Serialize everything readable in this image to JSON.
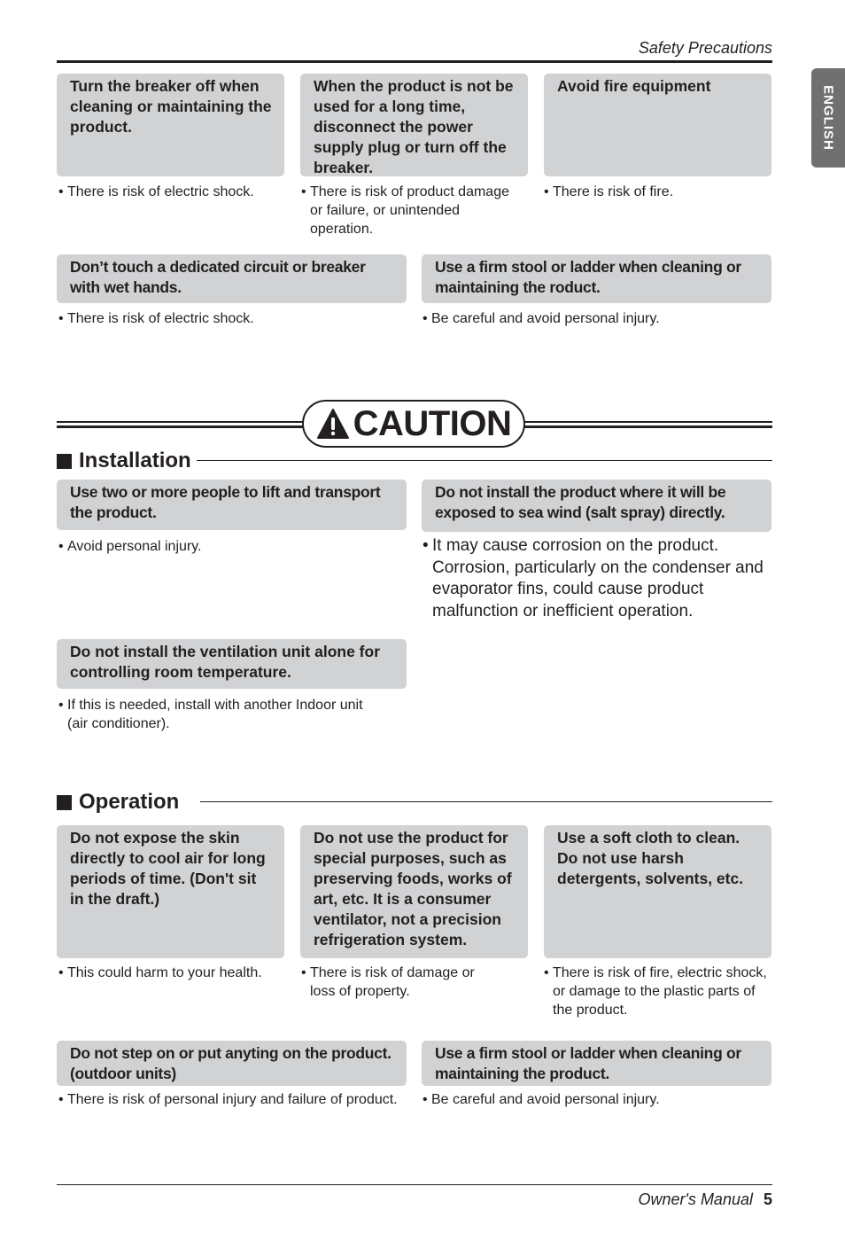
{
  "header": {
    "title": "Safety Precautions"
  },
  "language_tab": "ENGLISH",
  "top_section": {
    "row1": [
      {
        "title": "Turn the breaker off when cleaning or maintaining the product.",
        "notes": [
          "There is risk of electric shock."
        ]
      },
      {
        "title": "When the product is not be used for a long time, disconnect the power supply plug or turn off the breaker.",
        "notes": [
          "There is risk of product damage or failure, or unintended operation."
        ]
      },
      {
        "title": "Avoid fire equipment",
        "notes": [
          "There is risk of fire."
        ]
      }
    ],
    "row2": [
      {
        "title": "Don’t touch a dedicated circuit or breaker with wet hands.",
        "notes": [
          "There is risk of electric shock."
        ]
      },
      {
        "title": "Use a firm stool or ladder when cleaning or maintaining the roduct.",
        "notes": [
          "Be careful and avoid personal injury."
        ]
      }
    ]
  },
  "caution": {
    "label": "CAUTION",
    "icon": "warning-triangle-icon"
  },
  "installation": {
    "heading": "Installation",
    "items": [
      {
        "title": "Use two or more people to lift and transport the product.",
        "notes": [
          "Avoid personal injury."
        ]
      },
      {
        "title": "Do not install the product where it will be exposed to sea wind (salt spray) directly.",
        "notes": [
          "It may cause corrosion on the product. Corrosion, particularly on the condenser and evaporator fins, could cause product malfunction or inefficient operation."
        ]
      },
      {
        "title": "Do not install the ventilation unit alone for controlling room temperature.",
        "notes": [
          "If this is needed, install with another Indoor unit (air conditioner)."
        ]
      }
    ]
  },
  "operation": {
    "heading": "Operation",
    "row1": [
      {
        "title": "Do not expose the skin directly to cool air for long periods of time. (Don't sit in the draft.)",
        "notes": [
          "This could harm to your health."
        ]
      },
      {
        "title": "Do not use the product for special purposes, such as preserving foods, works of art, etc. It is a consumer ventilator, not a precision refrigeration system.",
        "notes": [
          "There is risk of damage or loss of property."
        ]
      },
      {
        "title": "Use a soft cloth to clean. Do not use harsh detergents, solvents, etc.",
        "notes": [
          "There is risk of fire, electric shock, or damage to the plastic parts of the product."
        ]
      }
    ],
    "row2": [
      {
        "title": "Do not step on or put anyting on the product. (outdoor units)",
        "notes": [
          "There is risk of personal injury and failure of product."
        ]
      },
      {
        "title": "Use a firm stool or ladder when cleaning or maintaining the product.",
        "notes": [
          "Be careful and avoid personal injury."
        ]
      }
    ]
  },
  "footer": {
    "label": "Owner's Manual",
    "page": "5"
  },
  "bullet": "•"
}
